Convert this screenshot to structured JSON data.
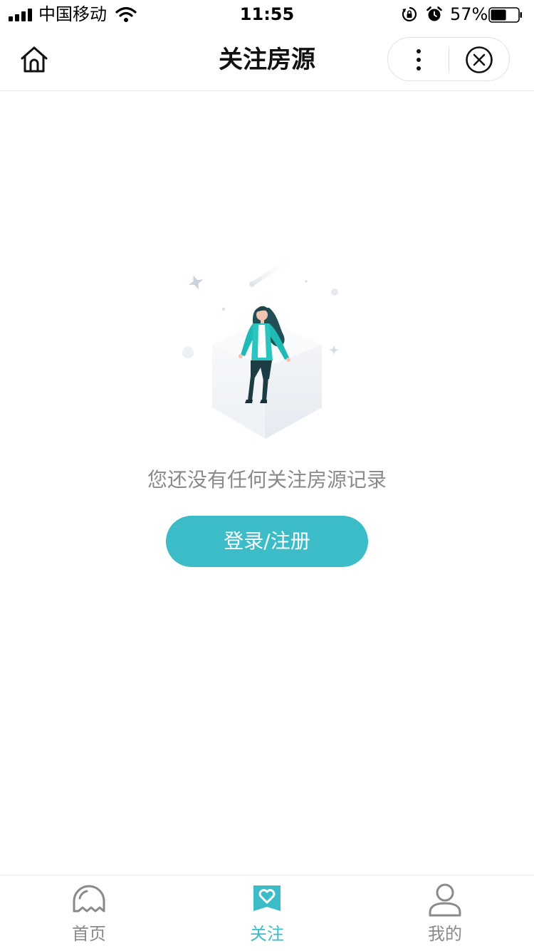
{
  "status_bar": {
    "carrier": "中国移动",
    "time": "11:55",
    "battery_percent": "57%",
    "battery_level": 0.57
  },
  "nav": {
    "title": "关注房源",
    "home_icon": "home-icon",
    "more_icon": "more-vertical-icon",
    "close_icon": "close-circle-icon"
  },
  "empty_state": {
    "message": "您还没有任何关注房源记录",
    "button_label": "登录/注册"
  },
  "tabs": [
    {
      "label": "首页",
      "icon": "home-ghost-icon",
      "active": false
    },
    {
      "label": "关注",
      "icon": "heart-bookmark-icon",
      "active": true
    },
    {
      "label": "我的",
      "icon": "user-icon",
      "active": false
    }
  ],
  "colors": {
    "accent": "#3bbcc6",
    "muted_text": "#8a8a8a",
    "title_text": "#111111"
  }
}
